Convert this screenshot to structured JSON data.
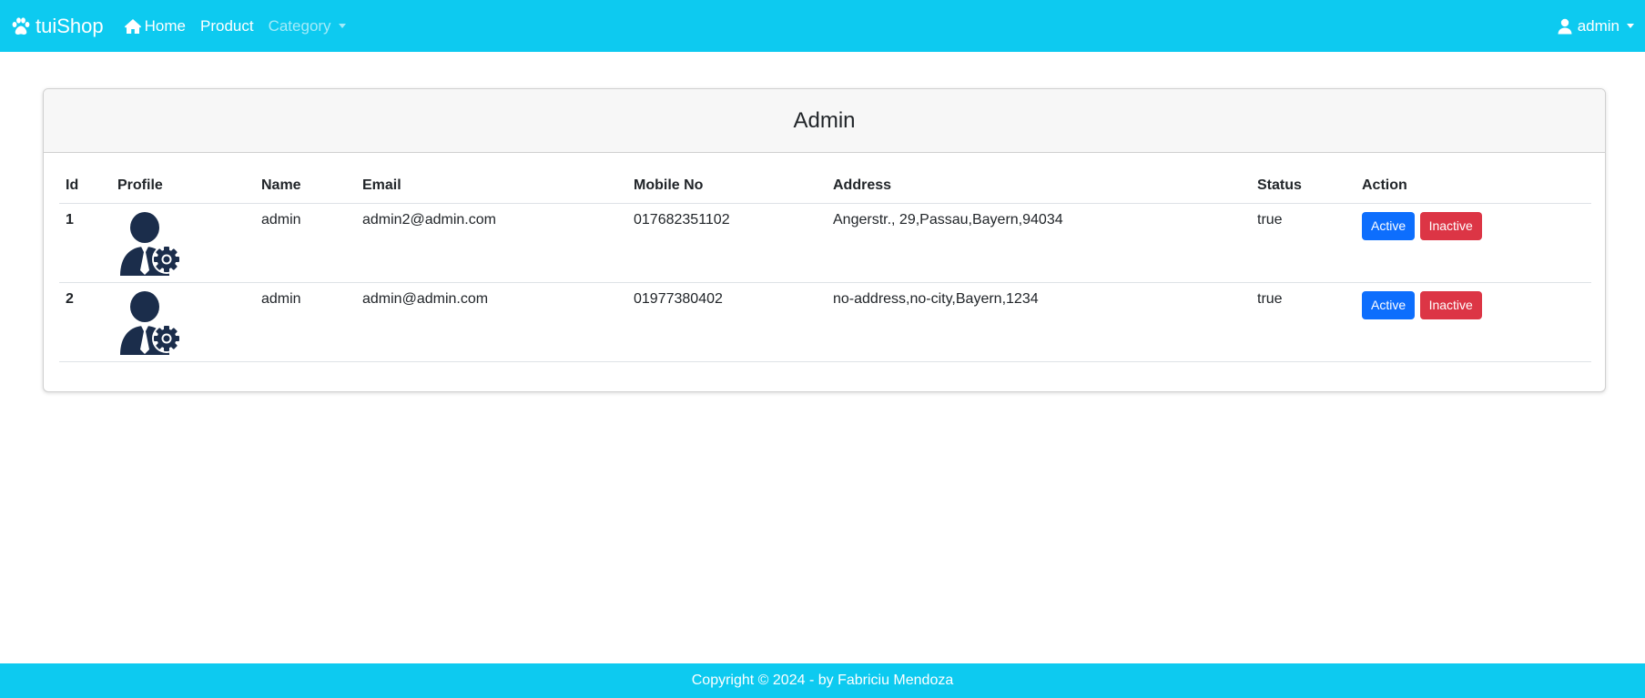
{
  "navbar": {
    "brand": "tuiShop",
    "brand_icon": "paw-icon",
    "home": "Home",
    "home_icon": "home-icon",
    "product": "Product",
    "category": "Category",
    "user": "admin",
    "user_icon": "user-icon"
  },
  "card": {
    "title": "Admin"
  },
  "table": {
    "headers": [
      "Id",
      "Profile",
      "Name",
      "Email",
      "Mobile No",
      "Address",
      "Status",
      "Action"
    ],
    "rows": [
      {
        "id": "1",
        "profile_icon": "admin-avatar-icon",
        "name": "admin",
        "email": "admin2@admin.com",
        "mobile": "017682351102",
        "address": "Angerstr., 29,Passau,Bayern,94034",
        "status": "true",
        "active_label": "Active",
        "inactive_label": "Inactive"
      },
      {
        "id": "2",
        "profile_icon": "admin-avatar-icon",
        "name": "admin",
        "email": "admin@admin.com",
        "mobile": "01977380402",
        "address": "no-address,no-city,Bayern,1234",
        "status": "true",
        "active_label": "Active",
        "inactive_label": "Inactive"
      }
    ]
  },
  "footer": {
    "text": "Copyright © 2024 - by Fabriciu Mendoza"
  },
  "colors": {
    "navbar": "#0dcaf0",
    "primary": "#0d6efd",
    "danger": "#dc3545",
    "avatar": "#1b2d4b"
  }
}
